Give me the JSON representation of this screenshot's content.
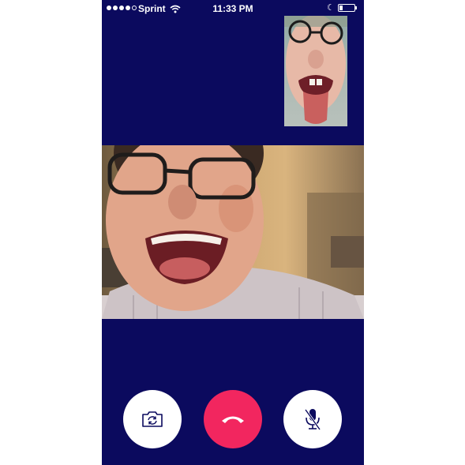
{
  "status_bar": {
    "carrier": "Sprint",
    "time": "11:33 PM",
    "signal_bars_filled": 4,
    "signal_bars_total": 5,
    "icons": [
      "signal-dots-icon",
      "wifi-icon",
      "moon-icon",
      "battery-icon"
    ]
  },
  "call": {
    "remote_video": "remote-participant-video",
    "self_view": "self-view-video"
  },
  "controls": {
    "flip_camera": {
      "icon": "camera-flip-icon"
    },
    "end_call": {
      "icon": "phone-hangup-icon",
      "color": "#f2265f"
    },
    "mute": {
      "icon": "microphone-muted-icon"
    }
  },
  "colors": {
    "background": "#0b0a5e",
    "end_call": "#f2265f",
    "control_bg": "#ffffff"
  }
}
